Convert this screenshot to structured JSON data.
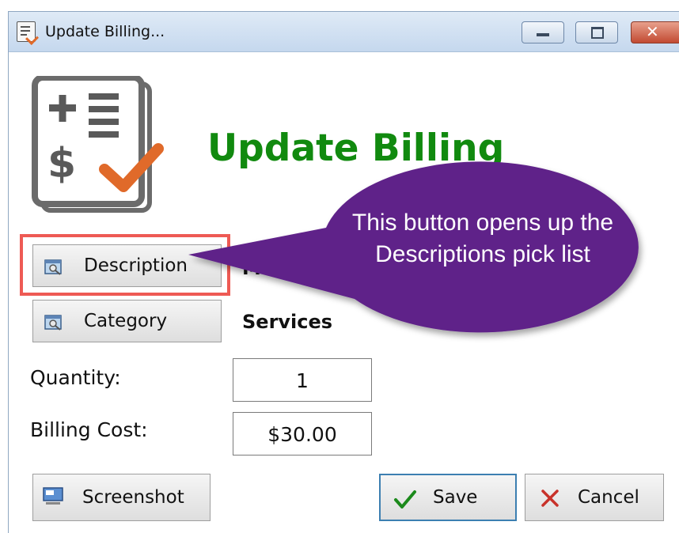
{
  "window": {
    "title": "Update Billing..."
  },
  "header": {
    "heading": "Update Billing"
  },
  "description_button": {
    "label": "Description"
  },
  "category_button": {
    "label": "Category"
  },
  "description_value": "Mo",
  "category_value": "Services",
  "quantity": {
    "label": "Quantity:",
    "value": "1"
  },
  "billing_cost": {
    "label": "Billing Cost:",
    "value": "$30.00"
  },
  "footer": {
    "screenshot_label": "Screenshot",
    "save_label": "Save",
    "cancel_label": "Cancel"
  },
  "callout": {
    "text": "This button opens up the Descriptions pick list"
  },
  "colors": {
    "heading": "#118a0f",
    "callout": "#5f2289",
    "highlight": "#ee5a54",
    "check": "#e06a2a"
  }
}
